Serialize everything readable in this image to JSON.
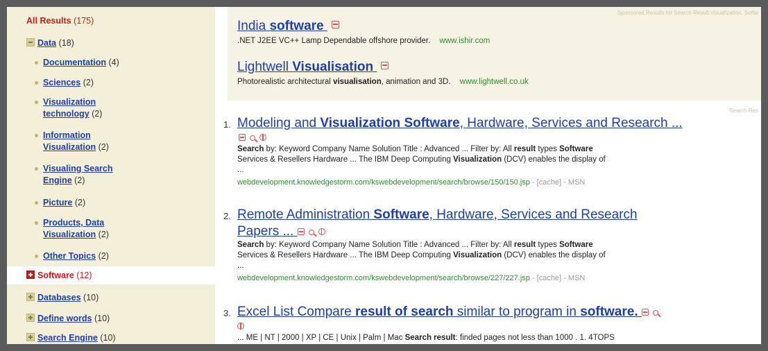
{
  "sidebar": {
    "all": {
      "label": "All Results",
      "count": "(175)"
    },
    "data": {
      "label": "Data",
      "count": "(18)"
    },
    "sub_items": [
      {
        "label": "Documentation",
        "count": "(4)"
      },
      {
        "label": "Sciences",
        "count": "(2)"
      },
      {
        "label": "Visualization technology",
        "count": "(2)"
      },
      {
        "label": "Information Visualization",
        "count": "(2)"
      },
      {
        "label": "Visualing Search Engine",
        "count": "(2)"
      },
      {
        "label": "Picture",
        "count": "(2)"
      },
      {
        "label": "Products, Data Visualization",
        "count": "(2)"
      },
      {
        "label": "Other Topics",
        "count": "(2)"
      }
    ],
    "software": {
      "label": "Software",
      "count": "(12)"
    },
    "others": [
      {
        "label": "Databases",
        "count": "(10)"
      },
      {
        "label": "Define words",
        "count": "(10)"
      },
      {
        "label": "Search Engine",
        "count": "(10)"
      }
    ]
  },
  "sponsored": {
    "note": "Sponsored Results for Search Result Visualization, Softw",
    "ads": [
      {
        "title_pre": "India ",
        "title_bold": "software",
        "desc": ".NET J2EE VC++ Lamp Dependable offshore provider.",
        "url": "www.ishir.com"
      },
      {
        "title_pre": "Lightwell ",
        "title_bold": "Visualisation",
        "desc_pre": "Photorealistic architectural ",
        "desc_bold": "visualisation",
        "desc_post": ", animation and 3D.",
        "url": "www.lightwell.co.uk"
      }
    ]
  },
  "results_label": "Search Res",
  "results": [
    {
      "num": "1.",
      "t1": "Modeling and ",
      "t2": "Visualization Software",
      "t3": ", Hardware, Services and Research ...",
      "s1": "Search",
      "s2": " by: Keyword Company Name Solution Title : Advanced ... Filter by: All ",
      "s3": "result",
      "s4": " types ",
      "s5": "Software",
      "s6": "Services & Resellers Hardware ... The IBM Deep Computing ",
      "s7": "Visualization",
      "s8": " (DCV) enables the display of",
      "s9": "...",
      "url": "webdevelopment.knowledgestorm.com/kswebdevelopment/search/browse/150/150.jsp",
      "meta": " - [cache] - MSN"
    },
    {
      "num": "2.",
      "t1": "Remote Administration ",
      "t2": "Software",
      "t3": ", Hardware, Services and Research",
      "t4": "Papers ...",
      "s1": "Search",
      "s2": " by: Keyword Company Name Solution Title : Advanced ... Filter by: All ",
      "s3": "result",
      "s4": " types ",
      "s5": "Software",
      "s6": "Services & Resellers Hardware ... The IBM Deep Computing ",
      "s7": "Visualization",
      "s8": " (DCV) enables the display of",
      "s9": "...",
      "url": "webdevelopment.knowledgestorm.com/kswebdevelopment/search/browse/227/227.jsp",
      "meta": " - [cache] - MSN"
    },
    {
      "num": "3.",
      "t1": "Excel List Compare ",
      "t2": "result of search",
      "t3": " similar to program in ",
      "t4": "software.",
      "s1": "... ME | NT | 2000 | XP | CE | Unix | Palm | Mac ",
      "s2": "Search result",
      "s3": ": finded pages not less than 1000 . 1. 4TOPS"
    }
  ]
}
